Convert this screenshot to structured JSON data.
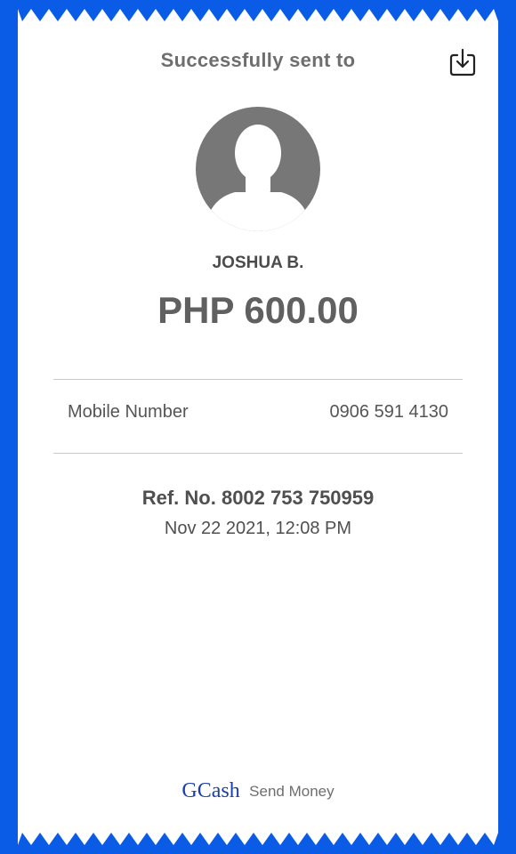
{
  "colors": {
    "background": "#0a5ce6",
    "receipt": "#ffffff",
    "brand": "#1a3fa8",
    "avatar": "#777777"
  },
  "header": {
    "title": "Successfully sent to",
    "download_icon": "download-icon"
  },
  "recipient": {
    "avatar_icon": "person-silhouette-icon",
    "name": "JOSHUA B.",
    "amount": "PHP 600.00"
  },
  "details": {
    "label": "Mobile Number",
    "value": "0906 591 4130"
  },
  "reference": {
    "ref_no": "Ref. No. 8002 753 750959",
    "datetime": "Nov 22 2021, 12:08 PM"
  },
  "footer": {
    "brand": "GCash",
    "service": "Send Money"
  }
}
